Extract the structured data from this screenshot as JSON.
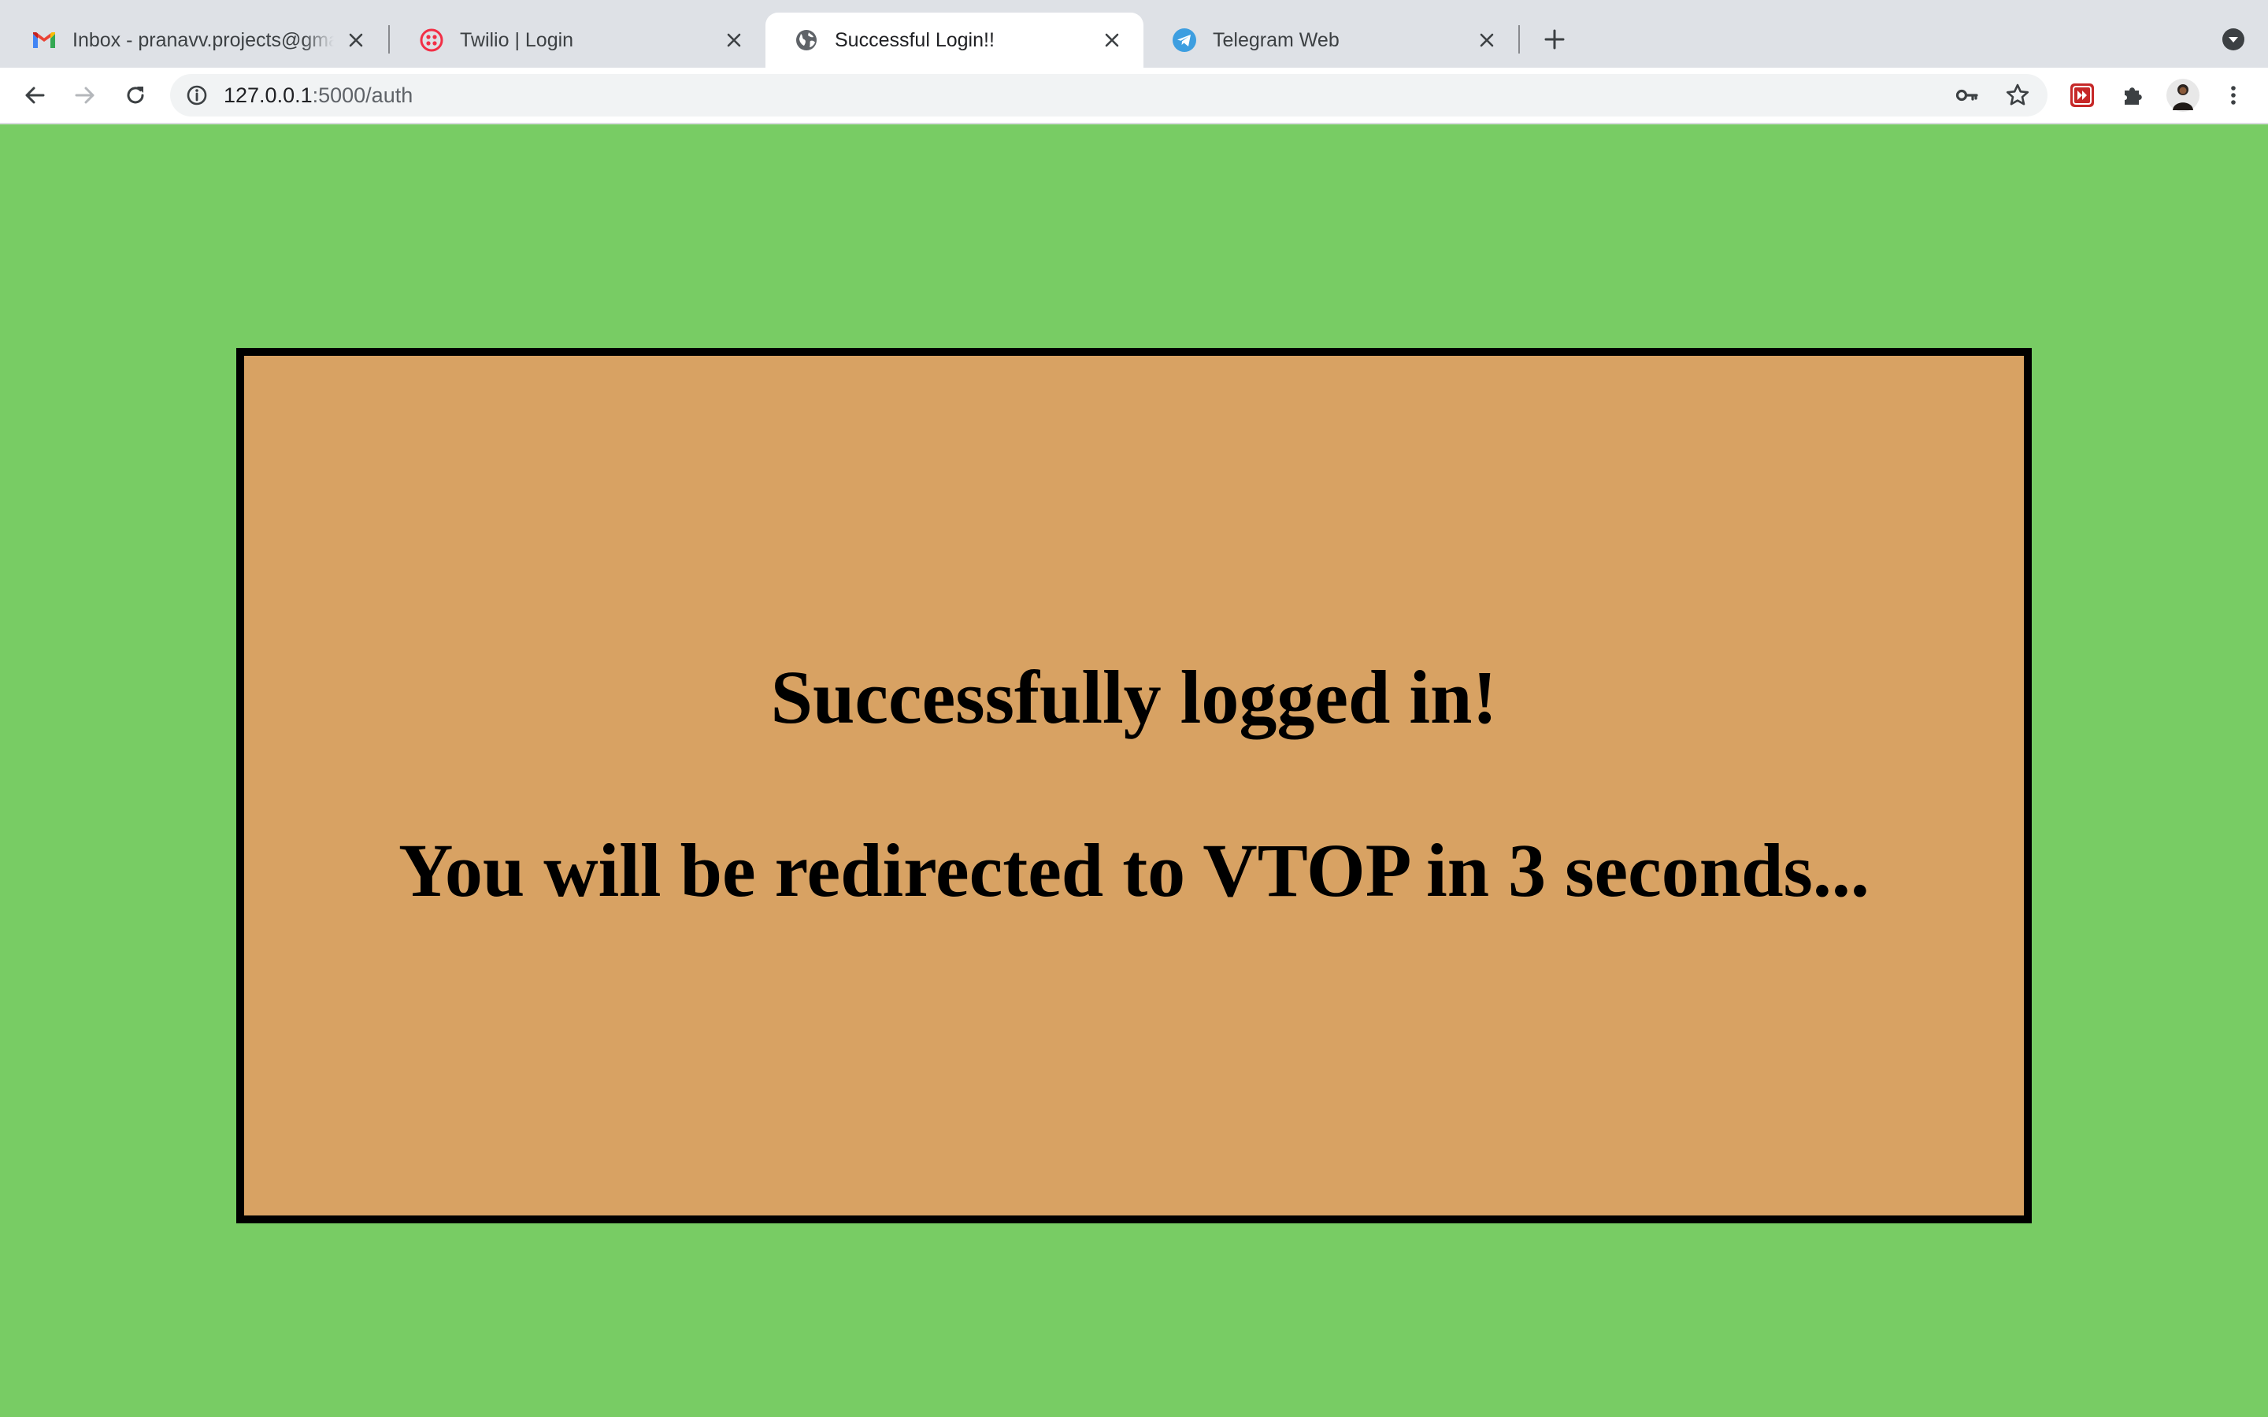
{
  "browser": {
    "tabs": [
      {
        "title": "Inbox - pranavv.projects@gmail.com",
        "icon": "gmail-icon",
        "active": false
      },
      {
        "title": "Twilio | Login",
        "icon": "twilio-icon",
        "active": false
      },
      {
        "title": "Successful Login!!",
        "icon": "globe-icon",
        "active": true
      },
      {
        "title": "Telegram Web",
        "icon": "telegram-icon",
        "active": false
      }
    ],
    "address_bar": {
      "url_host": "127.0.0.1",
      "url_path": ":5000/auth"
    }
  },
  "page": {
    "heading": "Successfully logged in!",
    "subheading": "You will be redirected to VTOP in 3 seconds...",
    "colors": {
      "background": "#78cc64",
      "card": "#d8a263",
      "card_border": "#000000",
      "text": "#000000"
    }
  }
}
